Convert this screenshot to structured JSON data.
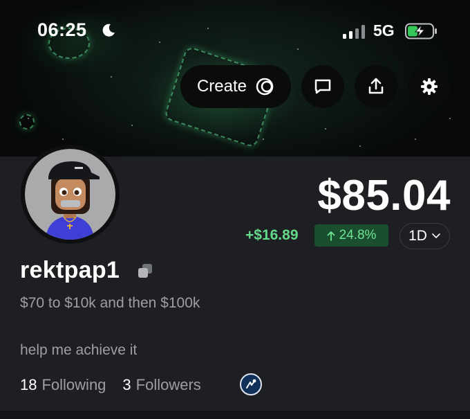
{
  "status_bar": {
    "time": "06:25",
    "network": "5G",
    "icons": [
      "moon-icon",
      "signal-icon",
      "battery-charging-icon"
    ]
  },
  "banner": {
    "create_label": "Create",
    "icons": [
      "create-circle-icon",
      "message-icon",
      "share-icon",
      "settings-icon"
    ]
  },
  "profile": {
    "username": "rektpap1",
    "bio_line1": "$70 to $10k and then $100k",
    "bio_line2": "help me achieve it",
    "following_count": "18",
    "following_label": "Following",
    "followers_count": "3",
    "followers_label": "Followers"
  },
  "portfolio": {
    "price": "$85.04",
    "change_abs": "+$16.89",
    "change_pct": "24.8%",
    "range": "1D"
  },
  "colors": {
    "background": "#1e1f23",
    "positive": "#63d989",
    "positive_bg": "#1b4d2f",
    "muted_text": "#9d9fa5"
  }
}
